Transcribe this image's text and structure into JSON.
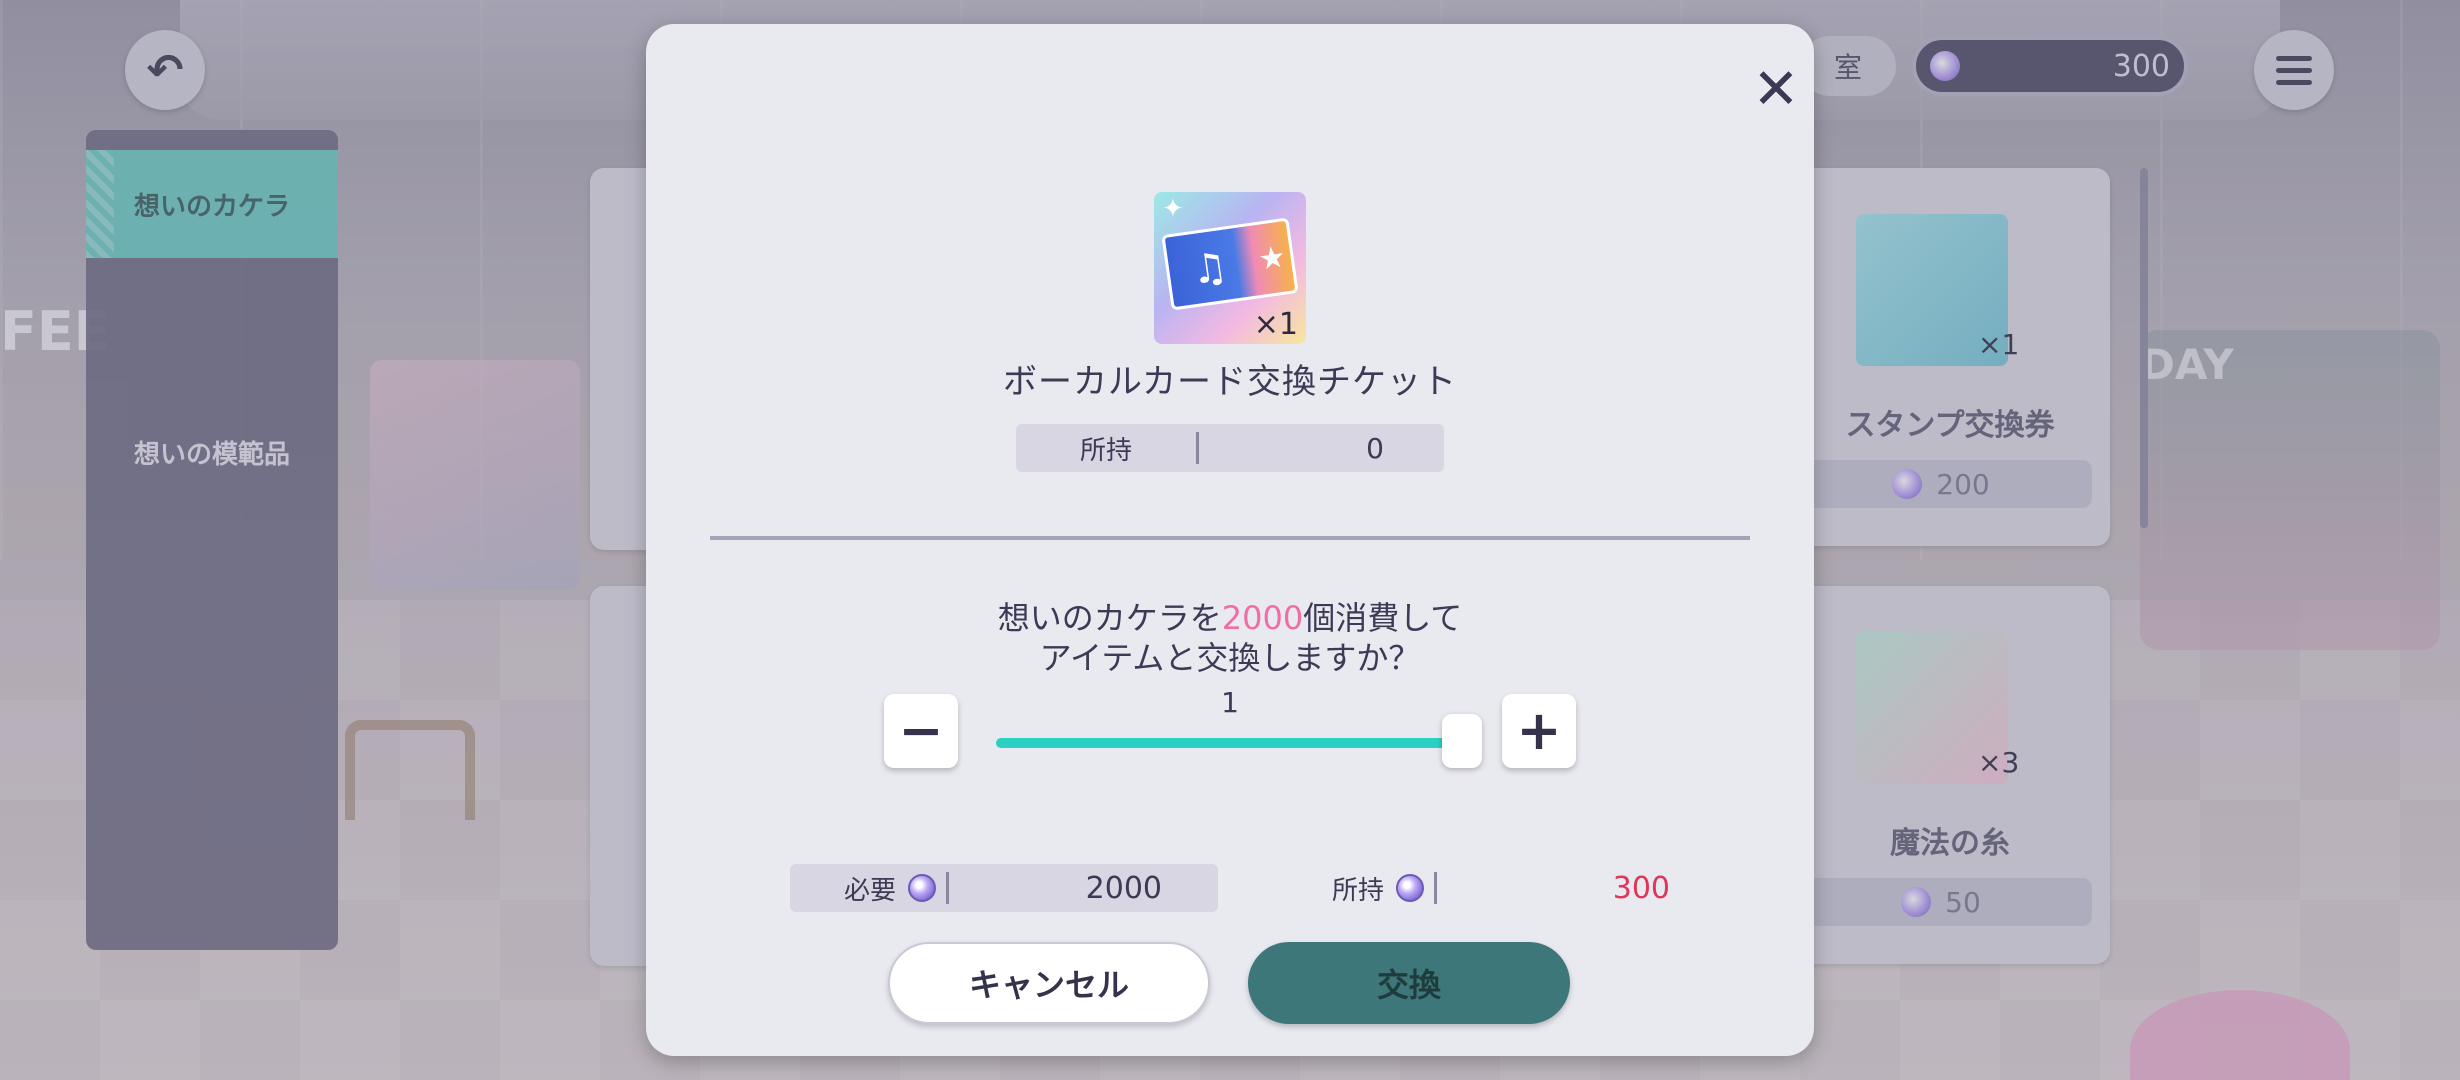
{
  "topbar": {
    "currency_value": "300",
    "left_pill_text": "室"
  },
  "sidebar": {
    "items": [
      {
        "label": "想いのカケラ",
        "active": true
      },
      {
        "label": "想いの模範品",
        "active": false
      }
    ]
  },
  "background_cards": [
    {
      "name": "スタンプ交換券",
      "qty": "×1",
      "price": "200"
    },
    {
      "name": "魔法の糸",
      "qty": "×3",
      "price": "50"
    }
  ],
  "background_text": {
    "left_sign": "FEE",
    "right_sign": "DAY"
  },
  "modal": {
    "close_label": "✕",
    "item": {
      "name": "ボーカルカード交換チケット",
      "qty_badge": "×1",
      "owned_label": "所持",
      "owned_value": "0"
    },
    "confirm": {
      "prefix": "想いのカケラを",
      "amount": "2000",
      "suffix": "個消費して",
      "line2": "アイテムと交換しますか？"
    },
    "quantity": {
      "value": "1",
      "min": 1,
      "max": 1,
      "fill_fraction": 1.0,
      "minus_label": "−",
      "plus_label": "+"
    },
    "cost": {
      "required_label": "必要",
      "required_value": "2000",
      "have_label": "所持",
      "have_value": "300"
    },
    "buttons": {
      "cancel": "キャンセル",
      "exchange": "交換"
    }
  },
  "colors": {
    "accent_teal": "#2ad1c2",
    "exchange_button": "#3d7779",
    "highlight_pink": "#f06ea5",
    "insufficient_red": "#e0365a"
  }
}
